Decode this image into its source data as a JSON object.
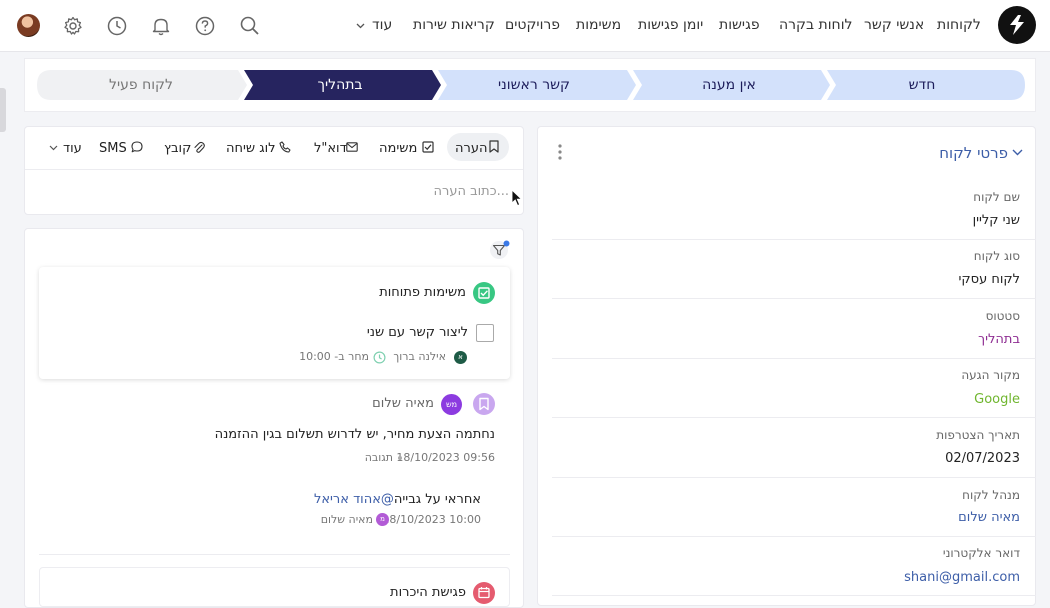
{
  "nav": {
    "items": [
      "לקוחות",
      "אנשי קשר",
      "לוחות בקרה",
      "פגישות",
      "יומן פגישות",
      "משימות",
      "פרויקטים",
      "קריאות שירות",
      "עוד"
    ]
  },
  "icons": [
    "search-icon",
    "help-icon",
    "bell-icon",
    "clock-icon",
    "gear-icon"
  ],
  "pipeline": {
    "stages": [
      "חדש",
      "אין מענה",
      "קשר ראשוני",
      "בתהליך",
      "לקוח פעיל"
    ],
    "active_index": 3,
    "colors": {
      "active": "#26245f",
      "upcoming": "#d3e1fb",
      "inactive": "#f0f1f3"
    }
  },
  "details": {
    "title": "פרטי לקוח",
    "fields": [
      {
        "label": "שם לקוח",
        "value": "שני קליין",
        "color": "#222"
      },
      {
        "label": "סוג לקוח",
        "value": "לקוח עסקי",
        "color": "#222"
      },
      {
        "label": "סטטוס",
        "value": "בתהליך",
        "color": "#8e2d92"
      },
      {
        "label": "מקור הגעה",
        "value": "Google",
        "color": "#70b62f"
      },
      {
        "label": "תאריך הצטרפות",
        "value": "02/07/2023",
        "color": "#222"
      },
      {
        "label": "מנהל לקוח",
        "value": "מאיה שלום",
        "color": "#3d5ea8"
      },
      {
        "label": "דואר אלקטרוני",
        "value": "shani@gmail.com",
        "color": "#3d5ea8"
      }
    ]
  },
  "toolbar": {
    "note": "הערה",
    "task": "משימה",
    "email": "דוא\"ל",
    "call": "לוג שיחה",
    "file": "קובץ",
    "sms": "SMS",
    "more": "עוד",
    "placeholder": "כתוב הערה..."
  },
  "timeline": {
    "open_tasks_title": "משימות פתוחות",
    "task_title": "ליצור קשר עם שני",
    "task_owner": "אילנה ברוך",
    "task_owner_initial": "א",
    "task_due": "מחר ב- 10:00",
    "note_author": "מאיה שלום",
    "note_author_initials": "מש",
    "note_text": "נחתמה הצעת מחיר, יש לדרוש תשלום בגין ההזמנה",
    "note_time": "18/10/2023 09:56",
    "note_reply": "תגובה",
    "reply_mention": "@אהוד אריאל",
    "reply_text": " אחראי על גבייה",
    "reply_time": "18/10/2023 10:00",
    "reply_author": "מאיה שלום",
    "reply_author_initial": "מ",
    "meeting_title": "פגישת היכרות"
  }
}
